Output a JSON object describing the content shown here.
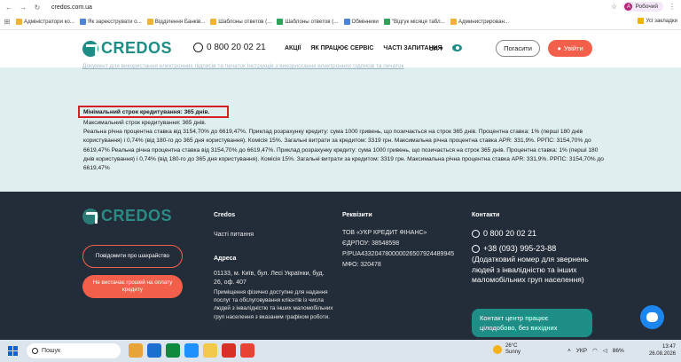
{
  "browser": {
    "url": "credos.com.ua",
    "profile_initial": "А",
    "profile_label": "Робочий",
    "bookmarks": [
      {
        "label": "Адміністратори ко...",
        "color": "#f2b233"
      },
      {
        "label": "Як зареєструвати о...",
        "color": "#4c84d6"
      },
      {
        "label": "Відділення Банків...",
        "color": "#f2b233"
      },
      {
        "label": "Шаблоны ответов (...",
        "color": "#f2b233"
      },
      {
        "label": "Шаблоны ответов (...",
        "color": "#2fa35a"
      },
      {
        "label": "Обмінники",
        "color": "#4c84d6"
      },
      {
        "label": "\"Відгук місяця табл...",
        "color": "#2fa35a"
      },
      {
        "label": "Администрирован...",
        "color": "#f2b233"
      }
    ],
    "all_bookmarks": "Усі закладки"
  },
  "header": {
    "logo": "CREDOS",
    "phone": "0 800 20 02 21",
    "menu": [
      "АКЦІЇ",
      "ЯК ПРАЦЮЄ СЕРВІС",
      "ЧАСТІ ЗАПИТАННЯ"
    ],
    "lang": "UA",
    "pay_label": "Погасити",
    "login_label": "Увійти"
  },
  "content": {
    "faded_links": "Документ для використання електронних підписів та печаток          Інструкція з використання електронних підписів та печаток",
    "min_term": "Мінімальний строк кредитування: 365 днів.",
    "max_term": "Максимальний строк кредитування: 365 днів.",
    "para1": "Реальна річна процентна ставка від 3154,70% до 6619,47%. Приклад розрахунку кредиту: сума 1000 гривень, що позичається на строк 365 днів. Процентна ставка: 1% (перші 180 днів користування) і 0,74% (від 180-го до 365 дня користування). Комісія 15%. Загальні витрати за кредитом: 3319 грн. Максимальна річна процентна ставка APR: 331,9%. РРПС: 3154,70% до 6619,47% Реальна річна процентна ставка від 3154,70% до 6619,47%. Приклад розрахунку кредиту: сума 1000 гривень, що позичається на строк 365 днів. Процентна ставка: 1% (перші 180 днів користування) і 0,74% (від 180-го до 365 дня користування). Комісія 15%. Загальні витрати за кредитом: 3319 грн. Максимальна річна процентна ставка APR: 331,9%. РРПС: 3154,70% до 6619,47%"
  },
  "footer": {
    "logo": "CREDOS",
    "report_btn": "Повідомити про шахрайство",
    "nomoney_btn": "Не вистачає грошей на оплату кредиту",
    "col1_title": "Credos",
    "col1_link": "Часті питання",
    "address_title": "Адреса",
    "address_text": "01133, м. Київ, бул. Лесі Українки, буд. 26, оф. 407",
    "address_note": "Приміщення фізично доступне для надання послуг та обслуговування клієнтів із числа людей з інвалідністю та інших маломобільних груп населення з вказаним графіком роботи.",
    "req_title": "Реквізити",
    "req_company": "ТОВ «УКР КРЕДИТ ФІНАНС»",
    "req_edrpou": "ЄДРПОУ: 38548598",
    "req_account": "Р/РUA433204780000026507924489945",
    "req_mfo": "МФО: 320478",
    "contacts_title": "Контакти",
    "contact_phone": "0 800 20 02 21",
    "contact_mobile": "+38 (093) 995-23-88",
    "contact_note": "(Додатковий номер для звернень людей з інвалідністю та інших маломобільних груп населення)",
    "support_text": "Контакт центр працює цілодобово, без вихідних"
  },
  "taskbar": {
    "search_placeholder": "Пошук",
    "weather_temp": "26°C",
    "weather_desc": "Sunny",
    "lang": "УКР",
    "battery": "86%",
    "time": "13:47",
    "date": "26.08.2026",
    "apps": [
      "#e8a33a",
      "#1c6fd1",
      "#0e8a3d",
      "#1e90ff",
      "#f2c94c",
      "#d93025",
      "#ea4335"
    ]
  }
}
